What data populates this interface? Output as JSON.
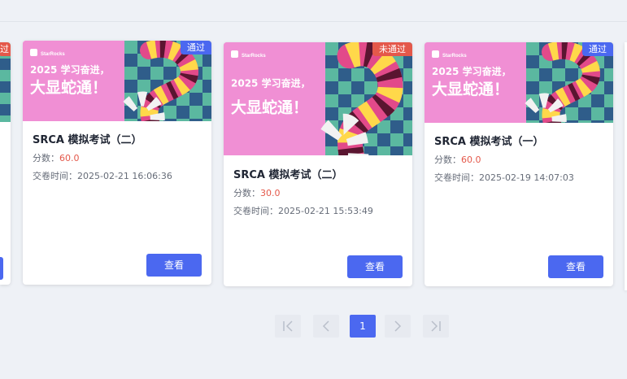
{
  "cards": [
    {
      "banner": {
        "brand": "StarRocks",
        "line1": "2025 学习奋进，",
        "line2": "大显蛇通！"
      },
      "status": "通过",
      "title": "SRCA 模拟考试（二）",
      "score_label": "分数：",
      "score_value": "60.0",
      "time_label": "交卷时间：",
      "time_value": "2025-02-21 16:06:36",
      "button": "查看"
    },
    {
      "banner": {
        "brand": "StarRocks",
        "line1": "2025 学习奋进，",
        "line2": "大显蛇通！"
      },
      "status": "未通过",
      "title": "SRCA 模拟考试（二）",
      "score_label": "分数：",
      "score_value": "30.0",
      "time_label": "交卷时间：",
      "time_value": "2025-02-21 15:53:49",
      "button": "查看"
    },
    {
      "banner": {
        "brand": "StarRocks",
        "line1": "2025 学习奋进，",
        "line2": "大显蛇通！"
      },
      "status": "通过",
      "title": "SRCA 模拟考试（一）",
      "score_label": "分数：",
      "score_value": "60.0",
      "time_label": "交卷时间：",
      "time_value": "2025-02-19 14:07:03",
      "button": "查看"
    }
  ],
  "partial_left_card": {
    "status": "过"
  },
  "pagination": {
    "first_icon": "first-page-icon",
    "prev_icon": "chevron-left-icon",
    "current_page": "1",
    "next_icon": "chevron-right-icon",
    "last_icon": "last-page-icon"
  },
  "colors": {
    "accent": "#4b68f0",
    "fail": "#e4584a",
    "banner_pink": "#f08fd4",
    "banner_teal": "#5bb8a0",
    "banner_navy": "#2f5d8a"
  }
}
